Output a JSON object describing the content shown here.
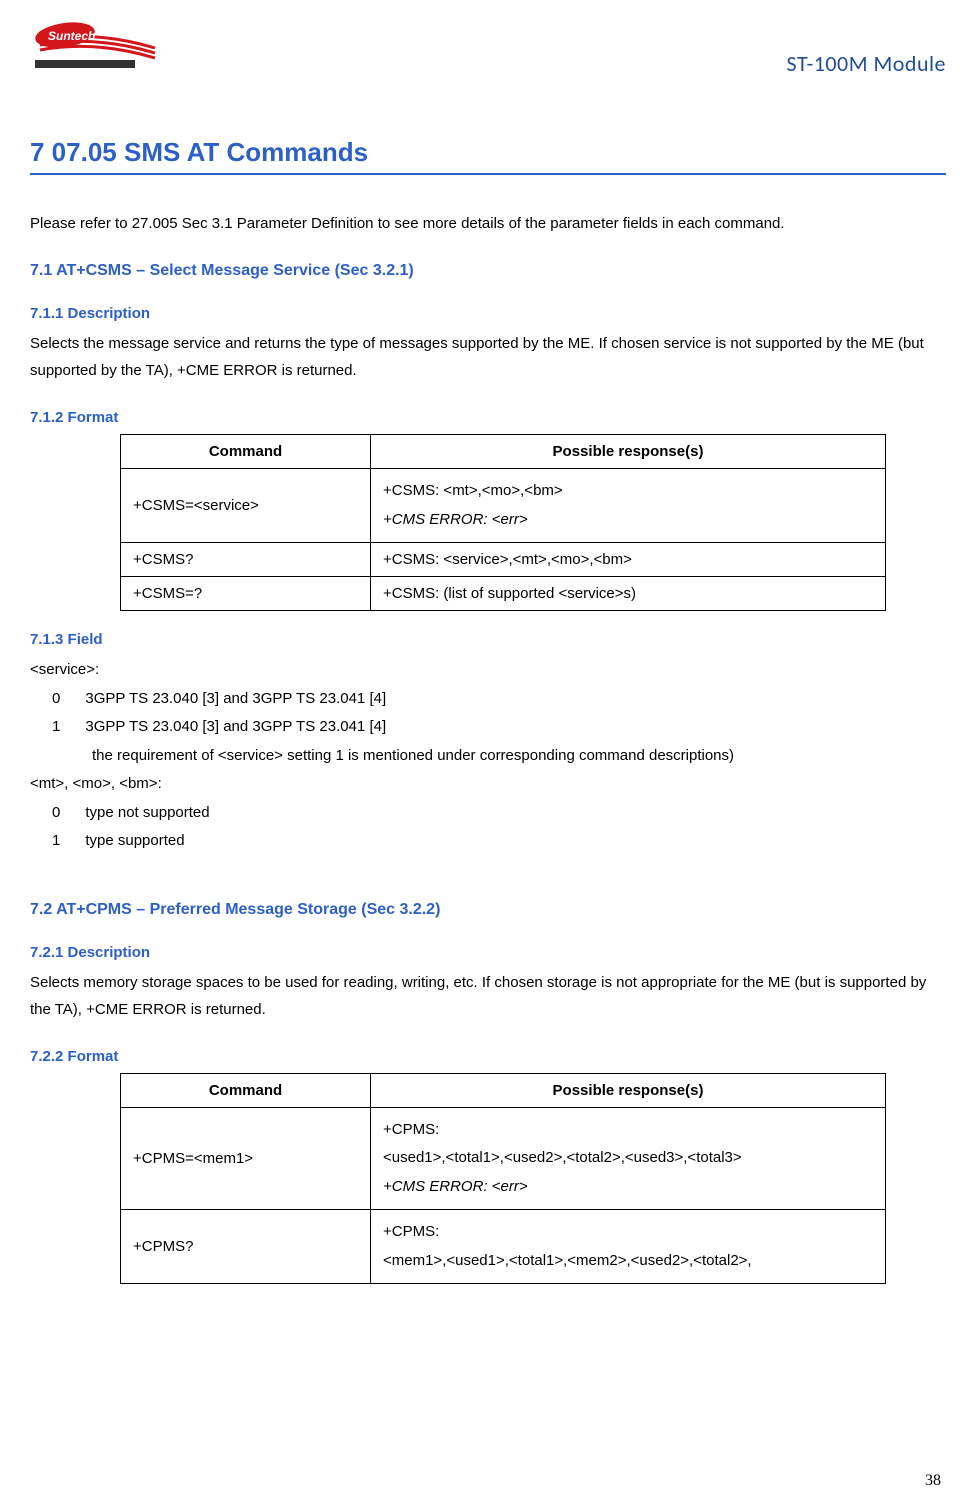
{
  "header": {
    "logo_text": "Suntech",
    "module_title": "ST-100M Module"
  },
  "main_title": "7 07.05 SMS AT Commands",
  "intro_text": "Please refer to 27.005 Sec 3.1 Parameter Definition to see more details of the parameter fields in each command.",
  "section_7_1": {
    "title": "7.1 AT+CSMS – Select Message Service (Sec 3.2.1)",
    "desc_title": "7.1.1 Description",
    "desc_text": "Selects the message service and returns the type of messages supported by the ME. If chosen service is not supported by the ME (but supported by the TA), +CME ERROR is returned.",
    "format_title": "7.1.2 Format",
    "table": {
      "headers": [
        "Command",
        "Possible response(s)"
      ],
      "rows": [
        {
          "cmd": "+CSMS=<service>",
          "resp_line1": "+CSMS: <mt>,<mo>,<bm>",
          "resp_line2": "+CMS ERROR: <err>"
        },
        {
          "cmd": "+CSMS?",
          "resp": "+CSMS: <service>,<mt>,<mo>,<bm>"
        },
        {
          "cmd": "+CSMS=?",
          "resp": "+CSMS: (list of supported <service>s)"
        }
      ]
    },
    "field_title": "7.1.3 Field",
    "field_service_label": "<service>:",
    "field_service_0": "0      3GPP TS 23.040 [3] and 3GPP TS 23.041 [4]",
    "field_service_1": "1      3GPP TS 23.040 [3] and 3GPP TS 23.041 [4]",
    "field_service_note": "the requirement of <service> setting 1 is mentioned under corresponding command descriptions)",
    "field_mtmobm_label": "<mt>, <mo>, <bm>:",
    "field_mtmobm_0": "0      type not supported",
    "field_mtmobm_1": "1      type supported"
  },
  "section_7_2": {
    "title": "7.2 AT+CPMS – Preferred Message Storage (Sec 3.2.2)",
    "desc_title": "7.2.1 Description",
    "desc_text": "Selects memory storage spaces to be used for reading, writing, etc. If chosen storage is not appropriate for the ME (but is supported by the TA), +CME ERROR is returned.",
    "format_title": "7.2.2 Format",
    "table": {
      "headers": [
        "Command",
        "Possible response(s)"
      ],
      "rows": [
        {
          "cmd": "+CPMS=<mem1>",
          "resp_line1": "+CPMS:",
          "resp_line2": "<used1>,<total1>,<used2>,<total2>,<used3>,<total3>",
          "resp_line3": "+CMS ERROR: <err>"
        },
        {
          "cmd": "+CPMS?",
          "resp_line1": "+CPMS:",
          "resp_line2": "<mem1>,<used1>,<total1>,<mem2>,<used2>,<total2>,"
        }
      ]
    }
  },
  "page_number": "38"
}
